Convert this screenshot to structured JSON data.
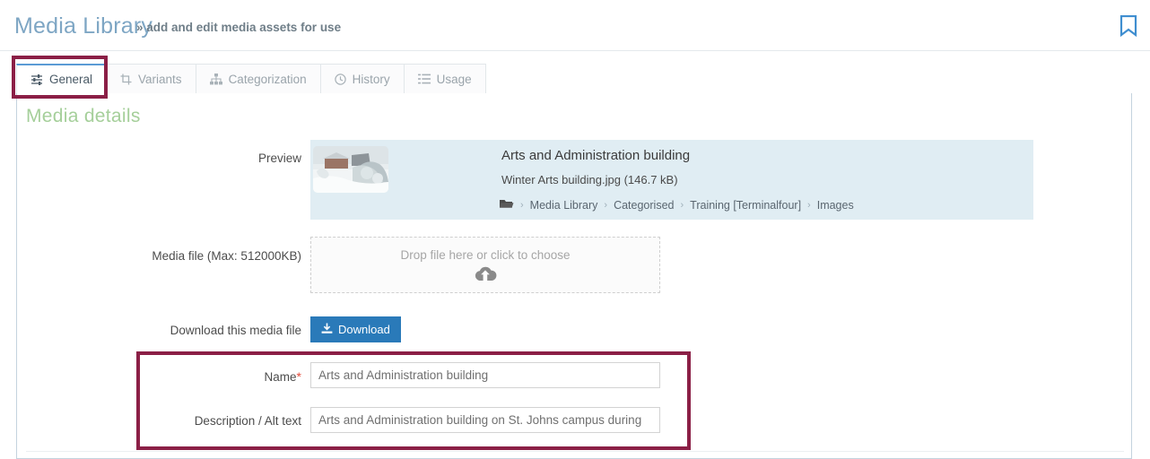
{
  "header": {
    "title": "Media Library",
    "subtitle": "» add and edit media assets for use",
    "bookmark_icon": "bookmark-icon",
    "title_color": "#7ea6c4"
  },
  "tabs": [
    {
      "label": "General",
      "icon": "sliders-icon",
      "active": true
    },
    {
      "label": "Variants",
      "icon": "crop-icon",
      "active": false
    },
    {
      "label": "Categorization",
      "icon": "sitemap-icon",
      "active": false
    },
    {
      "label": "History",
      "icon": "clock-icon",
      "active": false
    },
    {
      "label": "Usage",
      "icon": "list-icon",
      "active": false
    }
  ],
  "main": {
    "section_title": "Media details",
    "section_title_color": "#a5cf9a",
    "preview": {
      "label": "Preview",
      "title": "Arts and Administration building",
      "filename": "Winter Arts building.jpg (146.7 kB)",
      "folder_icon": "folder-icon",
      "breadcrumb": [
        "Media Library",
        "Categorised",
        "Training [Terminalfour]",
        "Images"
      ],
      "separator": "›",
      "background_color": "#e0edf3"
    },
    "media_file": {
      "label": "Media file (Max: 512000KB)",
      "dropzone_text": "Drop file here or click to choose",
      "dropzone_icon": "cloud-upload-icon"
    },
    "download": {
      "label": "Download this media file",
      "button_label": "Download",
      "button_icon": "download-icon",
      "button_color": "#2a7ab9"
    },
    "fields": [
      {
        "label": "Name",
        "required": true,
        "required_marker": "*",
        "value": "Arts and Administration building"
      },
      {
        "label": "Description / Alt text",
        "required": false,
        "required_marker": "",
        "value": "Arts and Administration building on St. Johns campus during"
      }
    ]
  },
  "annotations": {
    "highlight_color": "#8b1f46",
    "regions": [
      "general-tab",
      "name-and-description-fields"
    ]
  }
}
